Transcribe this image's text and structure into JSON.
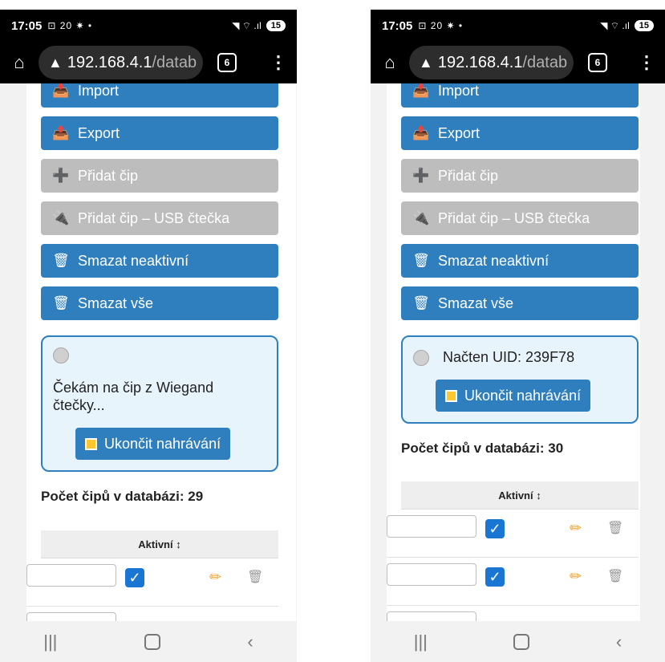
{
  "left": {
    "status": {
      "time": "17:05",
      "icons": "⊡ 20 ✷ •",
      "signal": "◥ ⌔ .ıl",
      "battery": "15"
    },
    "browser": {
      "url_host": "192.168.4.1",
      "url_path": "/datab",
      "tabs_count": "6"
    },
    "buttons": [
      {
        "label": "Import",
        "icon": "📥"
      },
      {
        "label": "Export",
        "icon": "📤"
      },
      {
        "label": "Přidat čip",
        "icon": "➕"
      },
      {
        "label": "Přidat čip – USB čtečka",
        "icon": "🔌"
      },
      {
        "label": "Smazat neaktivní",
        "icon": "🗑"
      },
      {
        "label": "Smazat vše",
        "icon": "🗑"
      }
    ],
    "wiegand": {
      "message_line1": "Čekám na čip z Wiegand",
      "message_line2": "čtečky...",
      "stop_label": "Ukončit nahrávání"
    },
    "count_label": "Počet čipů v databázi: 29",
    "table": {
      "header_active": "Aktivní ↕"
    }
  },
  "right": {
    "status": {
      "time": "17:05",
      "icons": "⊡ 20 ✷ •",
      "signal": "◥ ⌔ .ıl",
      "battery": "15"
    },
    "browser": {
      "url_host": "192.168.4.1",
      "url_path": "/datab",
      "tabs_count": "6"
    },
    "buttons": [
      {
        "label": "Import",
        "icon": "📥"
      },
      {
        "label": "Export",
        "icon": "📤"
      },
      {
        "label": "Přidat čip",
        "icon": "➕"
      },
      {
        "label": "Přidat čip – USB čtečka",
        "icon": "🔌"
      },
      {
        "label": "Smazat neaktivní",
        "icon": "🗑"
      },
      {
        "label": "Smazat vše",
        "icon": "🗑"
      }
    ],
    "wiegand": {
      "message": "Načten UID: 239F78",
      "stop_label": "Ukončit nahrávání"
    },
    "count_label": "Počet čipů v databázi: 30",
    "table": {
      "header_active": "Aktivní ↕"
    }
  },
  "icons": {
    "checkbox": "✓",
    "pencil": "✏",
    "trash": "🗑",
    "home": "⌂",
    "warning": "▲",
    "menu": "⋮",
    "nav_recent": "|||",
    "nav_back": "‹"
  },
  "colors": {
    "button_blue": "#2f7fbf",
    "button_gray": "#bdbdbd",
    "panel_border": "#2f7fbf",
    "panel_bg": "#e8f4fb",
    "checkbox": "#1976d2"
  }
}
